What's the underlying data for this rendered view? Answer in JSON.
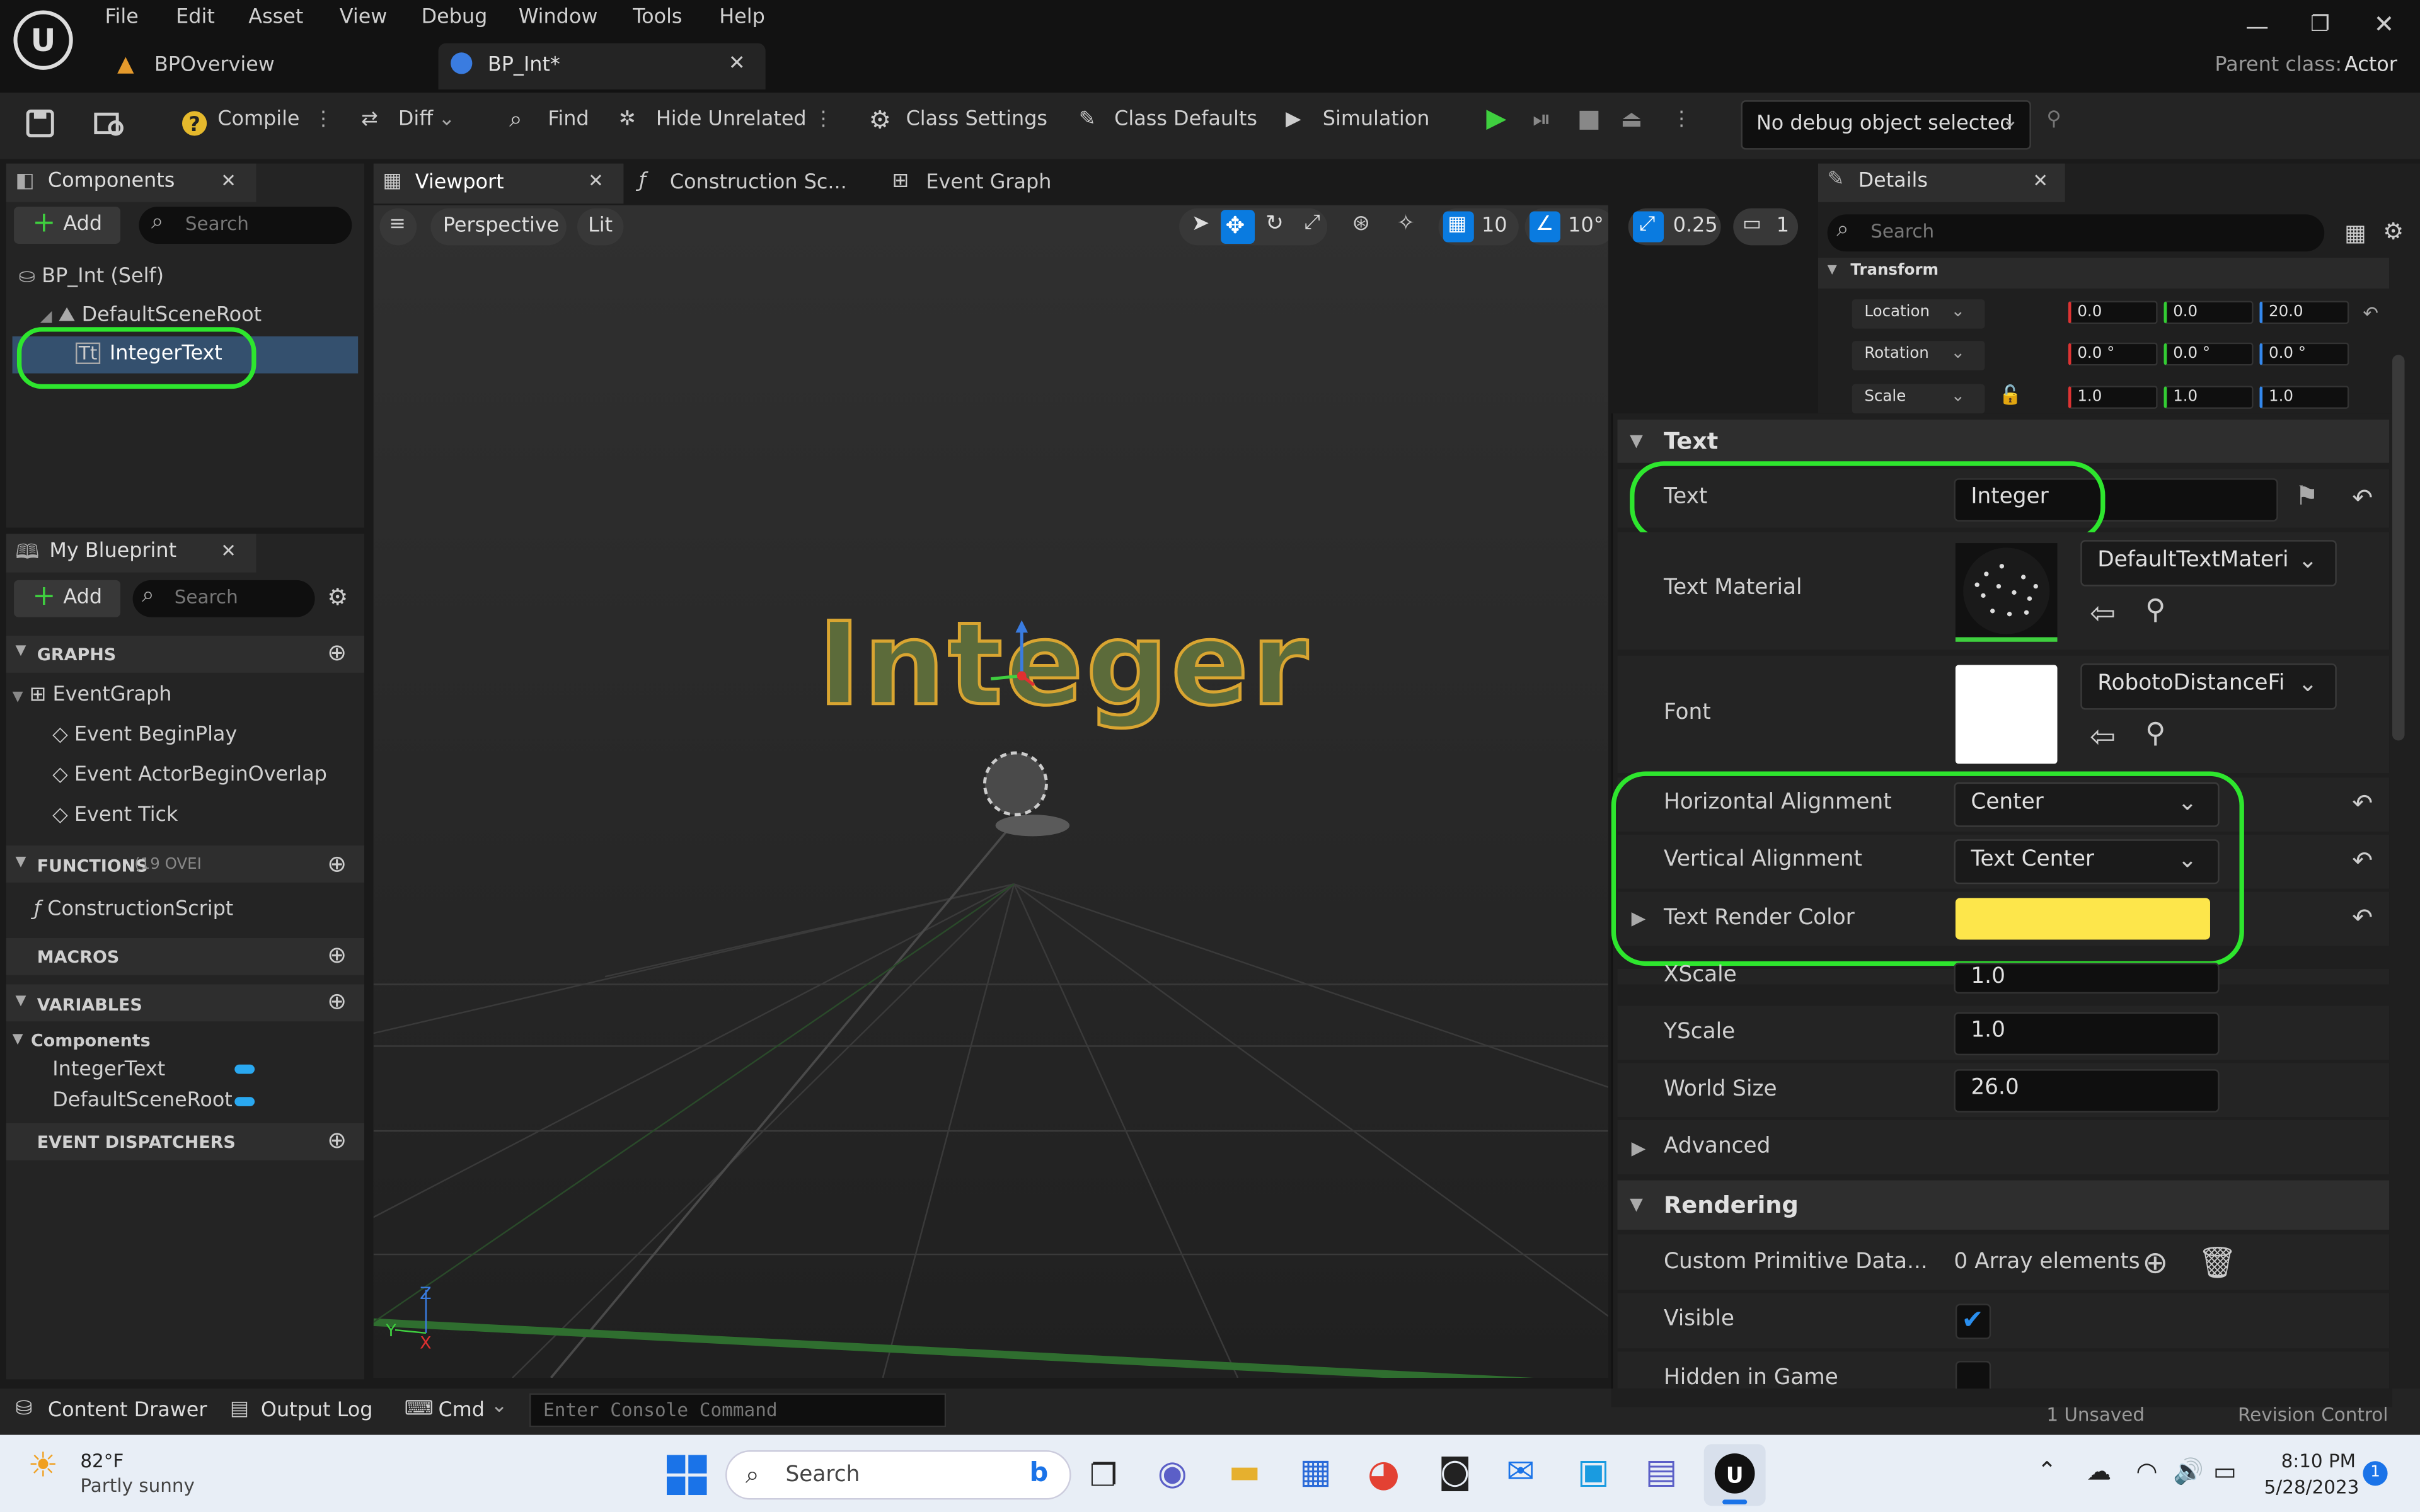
{
  "menu": [
    "File",
    "Edit",
    "Asset",
    "View",
    "Debug",
    "Window",
    "Tools",
    "Help"
  ],
  "tabs": {
    "doc1": "BPOverview",
    "doc2": "BP_Int*"
  },
  "parent_class": {
    "label": "Parent class:",
    "value": "Actor"
  },
  "toolbar": {
    "compile": "Compile",
    "diff": "Diff",
    "find": "Find",
    "hide_unrelated": "Hide Unrelated",
    "class_settings": "Class Settings",
    "class_defaults": "Class Defaults",
    "simulation": "Simulation",
    "debug_object": "No debug object selected"
  },
  "components": {
    "title": "Components",
    "add": "Add",
    "search_ph": "Search",
    "self": "BP_Int (Self)",
    "root": "DefaultSceneRoot",
    "text": "IntegerText"
  },
  "myblueprint": {
    "title": "My Blueprint",
    "add": "Add",
    "search_ph": "Search",
    "graphs": "GRAPHS",
    "eventgraph": "EventGraph",
    "ev1": "Event BeginPlay",
    "ev2": "Event ActorBeginOverlap",
    "ev3": "Event Tick",
    "functions": "FUNCTIONS",
    "functions_count": "(19 OVEI",
    "construction": "ConstructionScript",
    "macros": "MACROS",
    "variables": "VARIABLES",
    "comp_cat": "Components",
    "var1": "IntegerText",
    "var2": "DefaultSceneRoot",
    "dispatchers": "EVENT DISPATCHERS"
  },
  "viewport_tabs": {
    "viewport": "Viewport",
    "construction": "Construction Sc...",
    "eventgraph": "Event Graph"
  },
  "viewport": {
    "perspective": "Perspective",
    "lit": "Lit",
    "grid": "10",
    "angle": "10°",
    "scale": "0.25",
    "cam": "1",
    "text": "Integer"
  },
  "details": {
    "title": "Details",
    "search_ph": "Search",
    "transform": "Transform",
    "location": "Location",
    "rotation": "Rotation",
    "scale": "Scale",
    "loc": [
      "0.0",
      "0.0",
      "20.0"
    ],
    "rot": [
      "0.0 °",
      "0.0 °",
      "0.0 °"
    ],
    "scl": [
      "1.0",
      "1.0",
      "1.0"
    ],
    "text_section": "Text",
    "text_label": "Text",
    "text_value": "Integer",
    "material_label": "Text Material",
    "material_value": "DefaultTextMateri",
    "font_label": "Font",
    "font_value": "RobotoDistanceFi",
    "halign_label": "Horizontal Alignment",
    "halign_value": "Center",
    "valign_label": "Vertical Alignment",
    "valign_value": "Text Center",
    "color_label": "Text Render Color",
    "color_value": "#fde64b",
    "xscale_label": "XScale",
    "xscale_value": "1.0",
    "yscale_label": "YScale",
    "yscale_value": "1.0",
    "worldsize_label": "World Size",
    "worldsize_value": "26.0",
    "advanced": "Advanced",
    "rendering": "Rendering",
    "cpd_label": "Custom Primitive Data...",
    "cpd_value": "0 Array elements",
    "visible_label": "Visible",
    "hidden_label": "Hidden in Game",
    "unsaved": "1 Unsaved",
    "revision": "Revision Control"
  },
  "bottom": {
    "content_drawer": "Content Drawer",
    "output_log": "Output Log",
    "cmd": "Cmd",
    "console_ph": "Enter Console Command"
  },
  "taskbar": {
    "temp": "82°F",
    "weather": "Partly sunny",
    "search": "Search",
    "time": "8:10 PM",
    "date": "5/28/2023",
    "notif": "1"
  },
  "colors": {
    "accent_green": "#2ee62e",
    "blue": "#0a7be0"
  }
}
